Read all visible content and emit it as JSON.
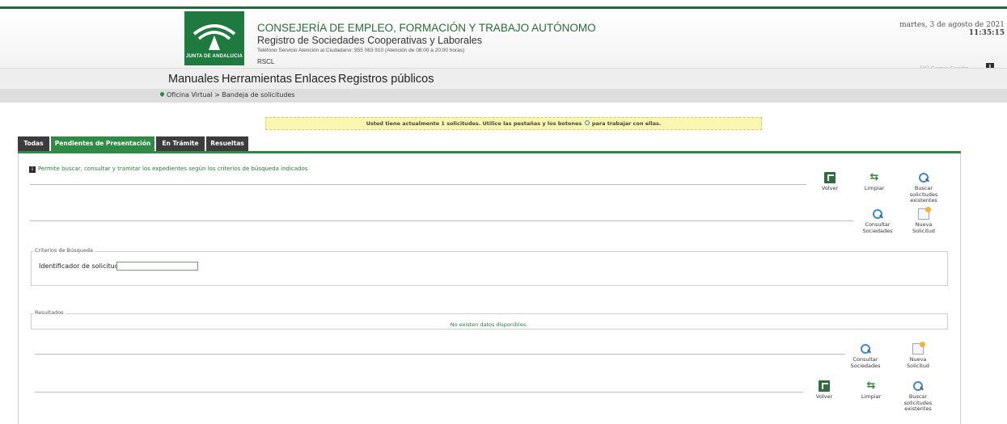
{
  "header": {
    "logo_text": "JUNTA DE ANDALUCIA",
    "title": "CONSEJERÍA DE EMPLEO, FORMACIÓN Y TRABAJO AUTÓNOMO",
    "subtitle": "Registro de Sociedades Cooperativas y Laborales",
    "phone": "Teléfono Servicio Atención al Ciudadano: 955 063 910 (Atención de 08:00 a 20:00 horas)",
    "code": "RSCL",
    "date": "martes, 3 de agosto de 2021",
    "time": "11:35:15",
    "logout": "[X] Cerrar Sesión",
    "info_glyph": "i"
  },
  "menu": {
    "items": [
      "Manuales",
      "Herramientas",
      "Enlaces",
      "Registros públicos"
    ]
  },
  "breadcrumb": "Oficina Virtual > Bandeja de solicitudes",
  "notice": {
    "before": "Usted tiene actualmente 1 solicitudes. Utilice las pestañas y los botones",
    "after": "para trabajar con ellas."
  },
  "tabs": [
    "Todas",
    "Pendientes de Presentación",
    "En Trámite",
    "Resueltas"
  ],
  "active_tab": "Pendientes de Presentación",
  "info_text": "Permite buscar, consultar y tramitar los expedientes según los criterios de búsqueda indicados",
  "actions": {
    "volver": "Volver",
    "limpiar": "Limpiar",
    "buscar": [
      "Buscar",
      "solicitudes",
      "existentes"
    ],
    "consultar": [
      "Consultar",
      "Sociedades"
    ],
    "nueva": [
      "Nueva",
      "Solicitud"
    ]
  },
  "search": {
    "legend": "Criterios de Búsqueda",
    "label": "Identificador de solicitud",
    "value": ""
  },
  "results": {
    "legend": "Resultados",
    "empty": "No existen datos disponibles."
  },
  "colors": {
    "brand_green": "#2f8a46",
    "notice_bg": "#fbf6b0",
    "tab_dark": "#3c3c3c"
  }
}
